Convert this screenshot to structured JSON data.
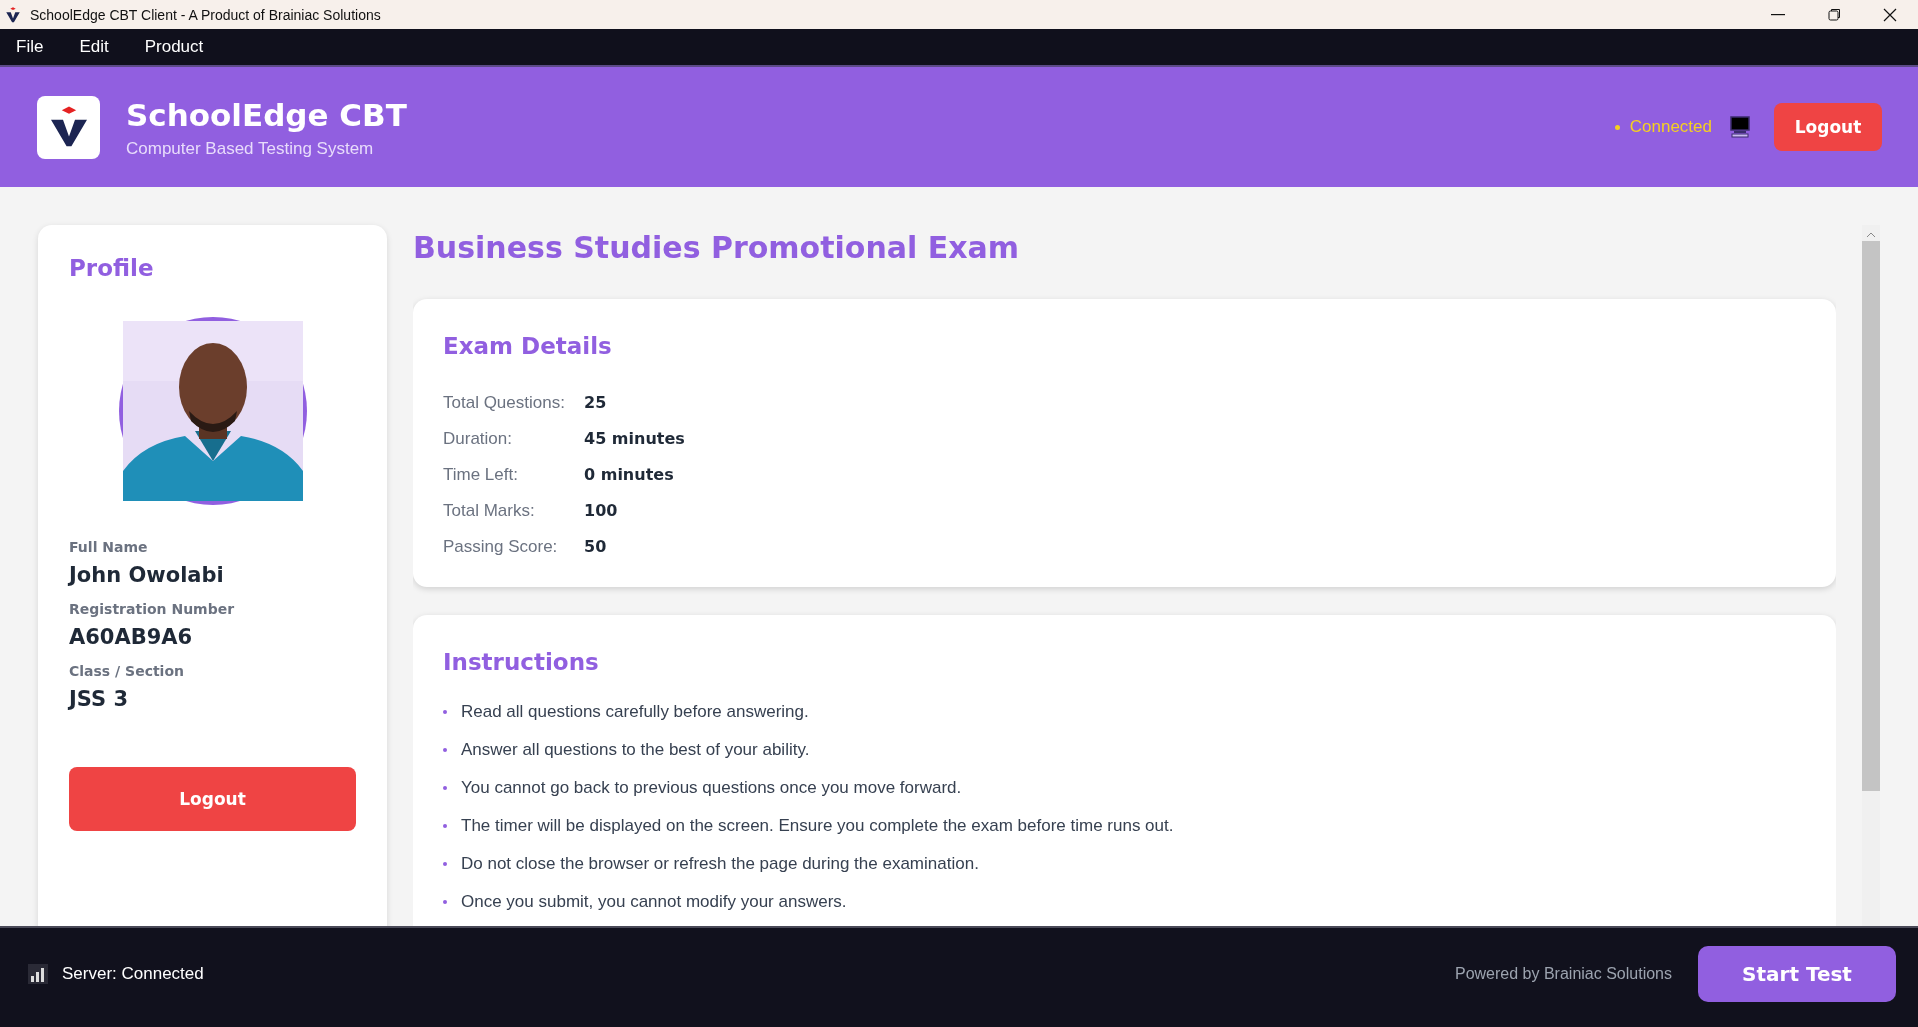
{
  "window": {
    "title": "SchoolEdge CBT Client - A Product of Brainiac Solutions"
  },
  "menu": [
    "File",
    "Edit",
    "Product"
  ],
  "header": {
    "title": "SchoolEdge CBT",
    "subtitle": "Computer Based Testing System",
    "status": "Connected",
    "logout": "Logout"
  },
  "profile": {
    "heading": "Profile",
    "fields": [
      {
        "label": "Full Name",
        "value": "John Owolabi"
      },
      {
        "label": "Registration Number",
        "value": "A60AB9A6"
      },
      {
        "label": "Class / Section",
        "value": "JSS 3"
      }
    ],
    "logout": "Logout"
  },
  "exam": {
    "title": "Business Studies Promotional Exam",
    "details": {
      "heading": "Exam Details",
      "rows": [
        {
          "label": "Total Questions:",
          "value": "25"
        },
        {
          "label": "Duration:",
          "value": "45 minutes"
        },
        {
          "label": "Time Left:",
          "value": "0 minutes"
        },
        {
          "label": "Total Marks:",
          "value": "100"
        },
        {
          "label": "Passing Score:",
          "value": "50"
        }
      ]
    },
    "instructions": {
      "heading": "Instructions",
      "items": [
        "Read all questions carefully before answering.",
        "Answer all questions to the best of your ability.",
        "You cannot go back to previous questions once you move forward.",
        "The timer will be displayed on the screen. Ensure you complete the exam before time runs out.",
        "Do not close the browser or refresh the page during the examination.",
        "Once you submit, you cannot modify your answers."
      ]
    }
  },
  "footer": {
    "server_status": "Server: Connected",
    "powered_by": "Powered by Brainiac Solutions",
    "start_button": "Start Test"
  }
}
